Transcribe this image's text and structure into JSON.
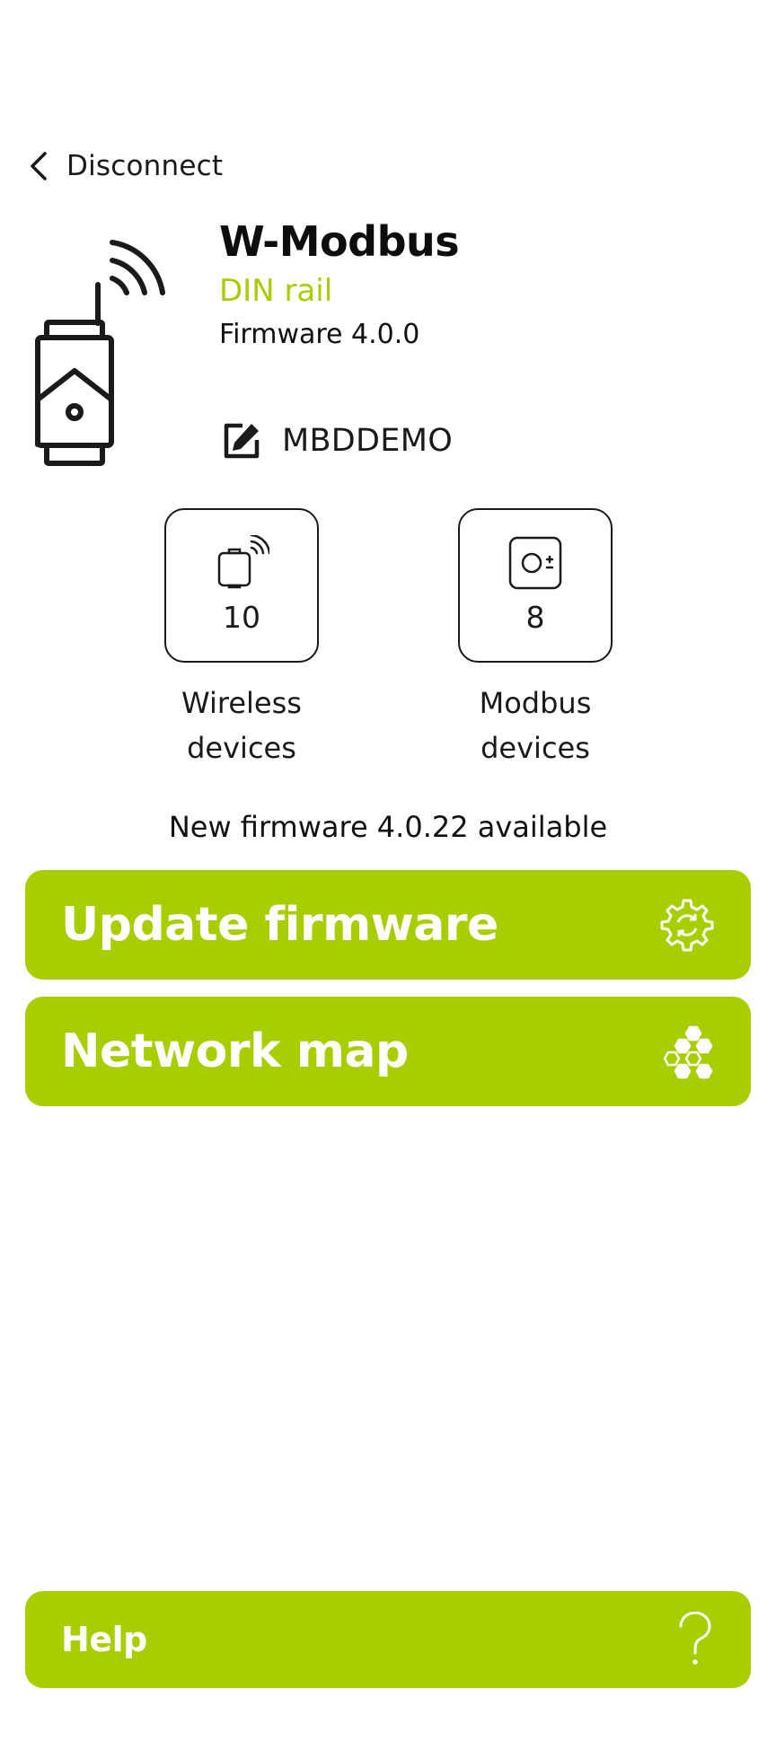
{
  "nav": {
    "back_label": "Disconnect",
    "back_icon": "chevron-left-icon"
  },
  "device": {
    "title": "W-Modbus",
    "subtitle": "DIN rail",
    "firmware": "Firmware 4.0.0",
    "name": "MBDDEMO",
    "edit_icon": "edit-icon",
    "illustration": "din-rail-gateway-icon"
  },
  "tiles": [
    {
      "icon": "wireless-device-icon",
      "count": "10",
      "caption_line1": "Wireless",
      "caption_line2": "devices"
    },
    {
      "icon": "modbus-device-icon",
      "count": "8",
      "caption_line1": "Modbus",
      "caption_line2": "devices"
    }
  ],
  "firmware_notice": "New firmware 4.0.22 available",
  "buttons": {
    "update_firmware": {
      "label": "Update firmware",
      "icon": "gear-refresh-icon"
    },
    "network_map": {
      "label": "Network map",
      "icon": "network-hexagon-icon"
    },
    "help": {
      "label": "Help",
      "icon": "question-mark-icon"
    }
  },
  "colors": {
    "accent": "#a8ce00",
    "text": "#111111",
    "background": "#ffffff"
  }
}
